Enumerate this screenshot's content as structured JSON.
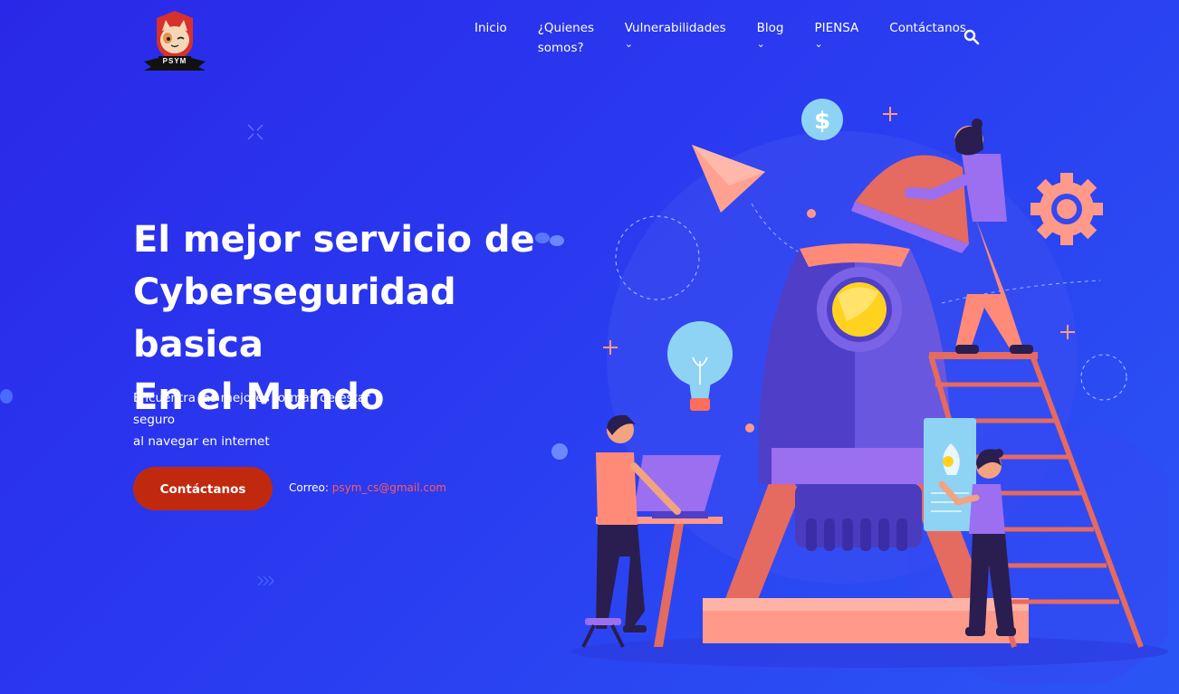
{
  "brand": {
    "logo_text": "PSYM"
  },
  "nav": {
    "items": [
      {
        "label": "Inicio",
        "dropdown": false
      },
      {
        "label": "¿Quienes somos?",
        "dropdown": false
      },
      {
        "label": "Vulnerabilidades",
        "dropdown": true
      },
      {
        "label": "Blog",
        "dropdown": true
      },
      {
        "label": "PIENSA",
        "dropdown": true
      },
      {
        "label": "Contáctanos",
        "dropdown": false
      }
    ],
    "search_icon": "search-icon"
  },
  "hero": {
    "title_line1": "El mejor servicio de",
    "title_line2": "Cyberseguridad basica",
    "title_line3": "En el Mundo",
    "subtitle_line1": "Encuentra las mejores formas de estar seguro",
    "subtitle_line2": "al navegar en internet",
    "cta_label": "Contáctanos",
    "email_label": "Correo:",
    "email_value": "psym_cs@gmail.com"
  },
  "colors": {
    "background_start": "#2a28e8",
    "background_end": "#2b55f5",
    "cta": "#c1290f",
    "email_link": "#ff5a5a"
  }
}
